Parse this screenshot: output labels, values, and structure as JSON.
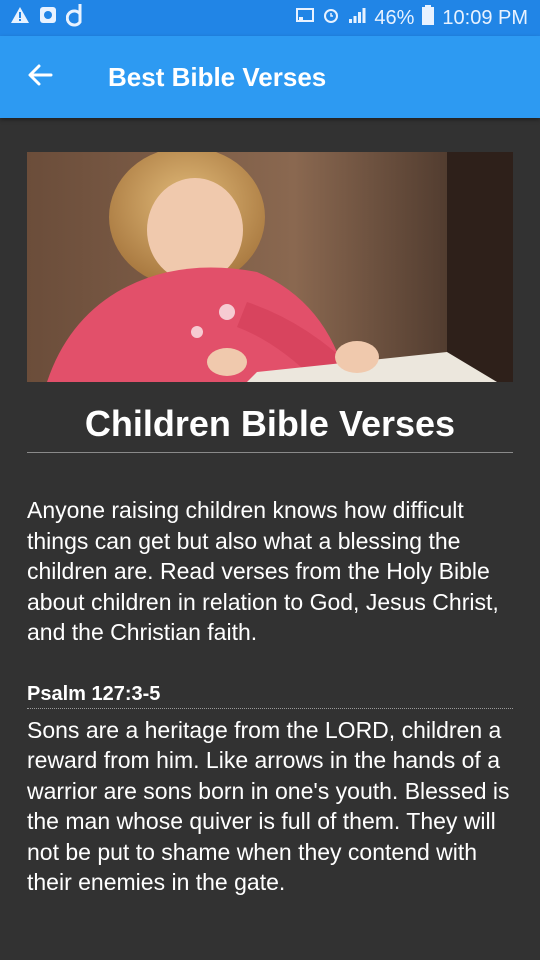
{
  "status_bar": {
    "battery": "46%",
    "time": "10:09 PM",
    "icons_left": [
      "warning-icon",
      "android-icon",
      "app-d-icon"
    ],
    "icons_right": [
      "cast-icon",
      "alarm-icon",
      "signal-icon",
      "battery-icon"
    ]
  },
  "app_bar": {
    "title": "Best Bible Verses",
    "back_icon": "arrow-left-icon",
    "color": "#2d9af2"
  },
  "article": {
    "title": "Children Bible Verses",
    "intro": "Anyone raising children knows how difficult things can get but also what a blessing the children are. Read verses from the Holy Bible about children in relation to God, Jesus Christ, and the Christian faith.",
    "verses": [
      {
        "reference": "Psalm 127:3-5",
        "text": "Sons are a heritage from the LORD, children a reward from him. Like arrows in the hands of a warrior are sons born in one's youth. Blessed is the man whose quiver is full of them. They will not be put to shame when they contend with their enemies in the gate."
      }
    ]
  },
  "colors": {
    "background": "#323232",
    "status_bar": "#2185e6",
    "text": "#ffffff"
  }
}
